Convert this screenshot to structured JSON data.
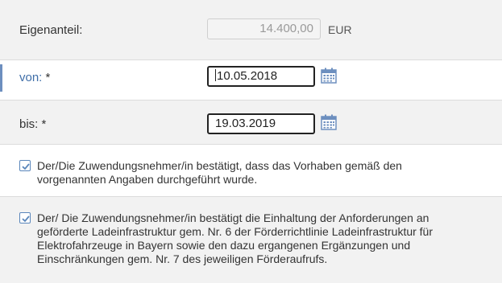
{
  "eigenanteil": {
    "label": "Eigenanteil:",
    "value": "14.400,00",
    "unit": "EUR"
  },
  "von": {
    "label": "von:",
    "required": "*",
    "value": "10.05.2018"
  },
  "bis": {
    "label": "bis:",
    "required": "*",
    "value": "19.03.2019"
  },
  "confirm1": {
    "checked": true,
    "lines": [
      "Der/Die Zuwendungsnehmer/in bestätigt, dass das Vorhaben gemäß den",
      "vorgenannten Angaben durchgeführt wurde."
    ]
  },
  "confirm2": {
    "checked": true,
    "lines": [
      "Der/ Die Zuwendungsnehmer/in bestätigt die Einhaltung der Anforderungen an",
      "geförderte Ladeinfrastruktur gem. Nr. 6 der Förderrichtlinie Ladeinfrastruktur für",
      "Elektrofahrzeuge in Bayern sowie den dazu ergangenen Ergänzungen und",
      "Einschränkungen gem. Nr. 7 des jeweiligen Förderaufrufs."
    ]
  },
  "icons": {
    "calendar": "calendar-icon",
    "checkbox": "checkmark-icon"
  },
  "colors": {
    "accent": "#3f6ea8",
    "row_shade": "#f2f2f2"
  }
}
